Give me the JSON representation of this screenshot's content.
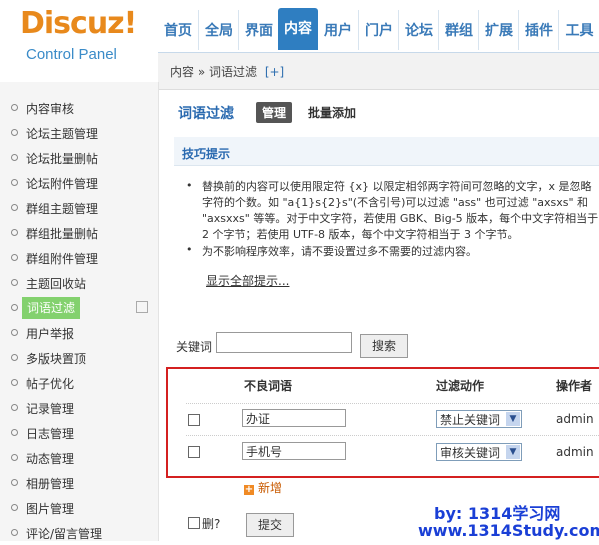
{
  "logo": {
    "word": "Discuz!",
    "sub": "Control Panel"
  },
  "topnav": [
    "首页",
    "全局",
    "界面",
    "内容",
    "用户",
    "门户",
    "论坛",
    "群组",
    "扩展",
    "插件",
    "工具"
  ],
  "topnav_active": "内容",
  "breadcrumb": {
    "text": "内容 » 词语过滤",
    "plus": "[+]"
  },
  "sidebar": [
    "内容审核",
    "论坛主题管理",
    "论坛批量删帖",
    "论坛附件管理",
    "群组主题管理",
    "群组批量删帖",
    "群组附件管理",
    "主题回收站",
    "词语过滤",
    "用户举报",
    "多版块置顶",
    "帖子优化",
    "记录管理",
    "日志管理",
    "动态管理",
    "相册管理",
    "图片管理",
    "评论/留言管理"
  ],
  "sidebar_active": "词语过滤",
  "page": {
    "title": "词语过滤",
    "tab_manage": "管理",
    "tab_batch": "批量添加"
  },
  "tips": {
    "title": "技巧提示",
    "tip1": "替换前的内容可以使用限定符 {x} 以限定相邻两字符间可忽略的文字，x 是忽略字符的个数。如 \"a{1}s{2}s\"(不含引号)可以过滤 \"ass\" 也可过滤 \"axsxs\" 和 \"axsxxs\" 等等。对于中文字符，若使用 GBK、Big-5 版本，每个中文字符相当于 2 个字节；若使用 UTF-8 版本，每个中文字符相当于 3 个字节。",
    "tip2": "为不影响程序效率，请不要设置过多不需要的过滤内容。",
    "show_all": "显示全部提示..."
  },
  "search": {
    "label": "关键词",
    "value": "",
    "button": "搜索"
  },
  "table": {
    "headers": [
      "不良词语",
      "过滤动作",
      "操作者"
    ],
    "rows": [
      {
        "word": "办证",
        "action": "禁止关键词",
        "operator": "admin"
      },
      {
        "word": "手机号",
        "action": "审核关键词",
        "operator": "admin"
      }
    ]
  },
  "add_new": "新增",
  "del_label": "删?",
  "submit": "提交",
  "watermark": {
    "line1": "by: 1314学习网",
    "line2": "www.1314Study.com"
  },
  "colors": {
    "accent": "#2f7ec1",
    "logo_orange": "#e8891c",
    "active_green": "#83d16e",
    "highlight_red": "#d42020",
    "watermark_blue": "#1a3fd6"
  }
}
